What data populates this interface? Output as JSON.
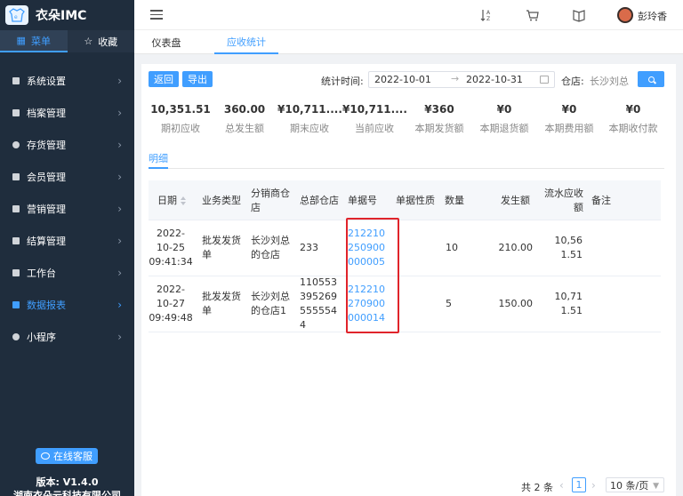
{
  "app": {
    "name": "衣朵IMC",
    "version": "版本: V1.4.0",
    "company": "湖南衣朵云科技有限公司"
  },
  "sidebar": {
    "tabs": [
      {
        "label": "菜单",
        "icon": "grid-icon"
      },
      {
        "label": "收藏",
        "icon": "star-icon"
      }
    ],
    "items": [
      {
        "label": "系统设置"
      },
      {
        "label": "档案管理"
      },
      {
        "label": "存货管理"
      },
      {
        "label": "会员管理"
      },
      {
        "label": "营销管理"
      },
      {
        "label": "结算管理"
      },
      {
        "label": "工作台"
      },
      {
        "label": "数据报表",
        "active": true
      },
      {
        "label": "小程序"
      }
    ],
    "service_label": "在线客服"
  },
  "topbar": {
    "username": "彭玲香"
  },
  "tabs": [
    {
      "label": "仪表盘"
    },
    {
      "label": "应收统计",
      "active": true
    }
  ],
  "toolbar": {
    "back_label": "返回",
    "export_label": "导出",
    "stat_time_label": "统计时间:",
    "date_start": "2022-10-01",
    "date_end": "2022-10-31",
    "warehouse_label": "仓店:",
    "warehouse_value": "长沙刘总"
  },
  "summary": [
    {
      "value": "10,351.51",
      "label": "期初应收"
    },
    {
      "value": "360.00",
      "label": "总发生额"
    },
    {
      "value": "¥10,711....",
      "label": "期末应收"
    },
    {
      "value": "¥10,711....",
      "label": "当前应收"
    },
    {
      "value": "¥360",
      "label": "本期发货额"
    },
    {
      "value": "¥0",
      "label": "本期退货额"
    },
    {
      "value": "¥0",
      "label": "本期费用额"
    },
    {
      "value": "¥0",
      "label": "本期收付款"
    }
  ],
  "detail_tab": "明细",
  "table": {
    "headers": {
      "date": "日期",
      "biz_type": "业务类型",
      "distributor": "分销商仓店",
      "hq_store": "总部仓店",
      "doc_no": "单据号",
      "doc_nature": "单据性质",
      "qty": "数量",
      "amount": "发生额",
      "flow": "流水应收额",
      "remark": "备注"
    },
    "rows": [
      {
        "date": "2022-10-25 09:41:34",
        "biz_type": "批发发货单",
        "distributor": "长沙刘总的仓店",
        "hq_store": "233",
        "doc_no": "212210250900000005",
        "doc_nature": "",
        "qty": "10",
        "amount": "210.00",
        "flow": "10,561.51",
        "remark": ""
      },
      {
        "date": "2022-10-27 09:49:48",
        "biz_type": "批发发货单",
        "distributor": "长沙刘总的仓店1",
        "hq_store": "1105533952695555544",
        "doc_no": "212210270900000014",
        "doc_nature": "",
        "qty": "5",
        "amount": "150.00",
        "flow": "10,711.51",
        "remark": ""
      }
    ]
  },
  "pagination": {
    "total": "共 2 条",
    "page": "1",
    "page_size": "10 条/页"
  }
}
